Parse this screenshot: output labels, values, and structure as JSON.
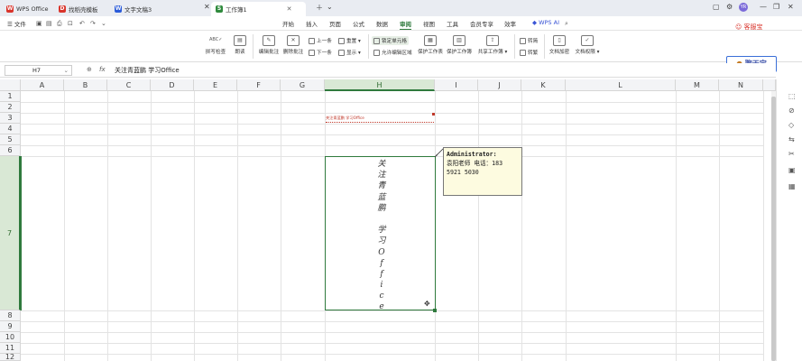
{
  "titlebar": {
    "tabs": [
      {
        "label": "WPS Office",
        "icon": "wps-logo-icon",
        "color": "#d9342b"
      },
      {
        "label": "找稻壳模板",
        "icon": "docer-icon",
        "color": "#d9342b"
      },
      {
        "label": "文字文稿3",
        "icon": "writer-icon",
        "color": "#2b5bd9"
      },
      {
        "label": "工作簿1",
        "icon": "spreadsheet-icon",
        "color": "#2f8a3d"
      }
    ],
    "avatar_text": "YR"
  },
  "menubar": {
    "file_label": "文件",
    "items": [
      "开始",
      "插入",
      "页面",
      "公式",
      "数据",
      "审阅",
      "视图",
      "工具",
      "会员专享",
      "效率"
    ],
    "active_index": 5,
    "ai_label": "WPS AI",
    "service_label": "客服宝"
  },
  "ribbon": {
    "spellcheck": "拼写检查",
    "read": "朗读",
    "edit_comment": "编辑批注",
    "delete_comment": "删除批注",
    "prev": "上一条",
    "next": "下一条",
    "reset": "重置",
    "show": "显示",
    "lock_cell": "锁定单元格",
    "allow_edit_area": "允许编辑区域",
    "protect_sheet": "保护工作表",
    "protect_workbook": "保护工作簿",
    "share_workbook": "共享工作簿",
    "simplify": "转简",
    "traditional": "转繁",
    "doc_encrypt": "文档加密",
    "doc_permission": "文档权限",
    "chat_bao": "聊天宝"
  },
  "formulabar": {
    "cell_ref": "H7",
    "fx": "fx",
    "content": "关注青蓝鹏 学习Office"
  },
  "columns": [
    "A",
    "B",
    "C",
    "D",
    "E",
    "F",
    "G",
    "H",
    "I",
    "J",
    "K",
    "L",
    "M",
    "N"
  ],
  "selected_column": "H",
  "rows": [
    "1",
    "2",
    "3",
    "4",
    "5",
    "6",
    "7",
    "8",
    "9",
    "10",
    "11",
    "12"
  ],
  "selected_row": "7",
  "cell_h3_text": "关注青蓝鹏 学习Office",
  "cell_h7_chars": [
    "关",
    "注",
    "青",
    "蓝",
    "鹏",
    "",
    "学",
    "习",
    "O",
    "f",
    "f",
    "i",
    "c",
    "e"
  ],
  "comment": {
    "author": "Administrator:",
    "line1": "袁阳老师 电话：183",
    "line2": "5921 5030"
  },
  "colors": {
    "accent": "#2f7a3d",
    "comment_bg": "#fdfbe0",
    "red_text": "#c0392b"
  }
}
